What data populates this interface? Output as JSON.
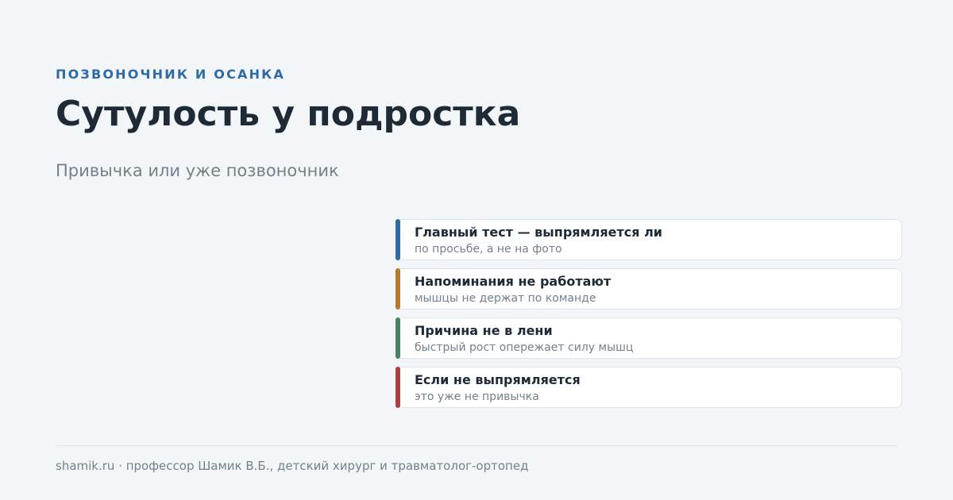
{
  "eyebrow": "ПОЗВОНОЧНИК И ОСАНКА",
  "title": "Сутулость у подростка",
  "subtitle": "Привычка или уже позвоночник",
  "cards": [
    {
      "title": "Главный тест — выпрямляется ли",
      "subtitle": "по просьбе, а не на фото",
      "accent": "#2e6aa4"
    },
    {
      "title": "Напоминания не работают",
      "subtitle": "мышцы не держат по команде",
      "accent": "#b57a2a"
    },
    {
      "title": "Причина не в лени",
      "subtitle": "быстрый рост опережает силу мышц",
      "accent": "#4a8064"
    },
    {
      "title": "Если не выпрямляется",
      "subtitle": "это уже не привычка",
      "accent": "#a8413f"
    }
  ],
  "footer": "shamik.ru · профессор Шамик В.Б., детский хирург и травматолог-ортопед"
}
